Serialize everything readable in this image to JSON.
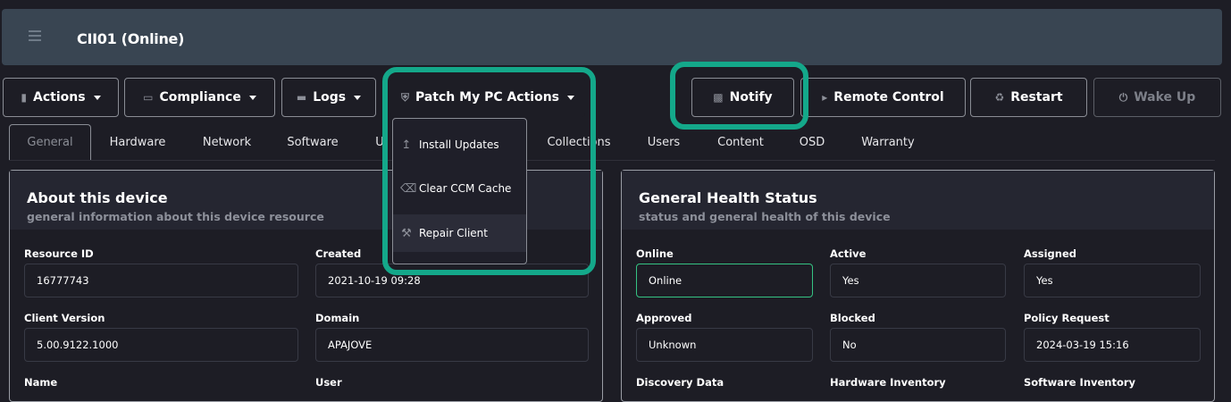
{
  "header": {
    "title": "CII01 (Online)"
  },
  "toolbar": {
    "actions": "Actions",
    "compliance": "Compliance",
    "logs": "Logs",
    "patch": "Patch My PC Actions",
    "notify": "Notify",
    "remote": "Remote Control",
    "restart": "Restart",
    "wake": "Wake Up"
  },
  "patch_menu": {
    "items": [
      "Install Updates",
      "Clear CCM Cache",
      "Repair Client"
    ]
  },
  "tabs": [
    "General",
    "Hardware",
    "Network",
    "Software",
    "U",
    "Collections",
    "Users",
    "Content",
    "OSD",
    "Warranty"
  ],
  "about": {
    "title": "About this device",
    "subtitle": "general information about this device resource",
    "resource_id_label": "Resource ID",
    "resource_id": "16777743",
    "created_label": "Created",
    "created": "2021-10-19 09:28",
    "client_version_label": "Client Version",
    "client_version": "5.00.9122.1000",
    "domain_label": "Domain",
    "domain": "APAJOVE",
    "name_label": "Name",
    "user_label": "User"
  },
  "health": {
    "title": "General Health Status",
    "subtitle": "status and general health of this device",
    "online_label": "Online",
    "online": "Online",
    "active_label": "Active",
    "active": "Yes",
    "assigned_label": "Assigned",
    "assigned": "Yes",
    "approved_label": "Approved",
    "approved": "Unknown",
    "blocked_label": "Blocked",
    "blocked": "No",
    "policy_label": "Policy Request",
    "policy": "2024-03-19 15:16",
    "discovery_label": "Discovery Data",
    "hwinv_label": "Hardware Inventory",
    "swinv_label": "Software Inventory"
  },
  "colors": {
    "highlight": "#14a88a",
    "online_border": "#35c383",
    "header_bg": "#394552"
  }
}
